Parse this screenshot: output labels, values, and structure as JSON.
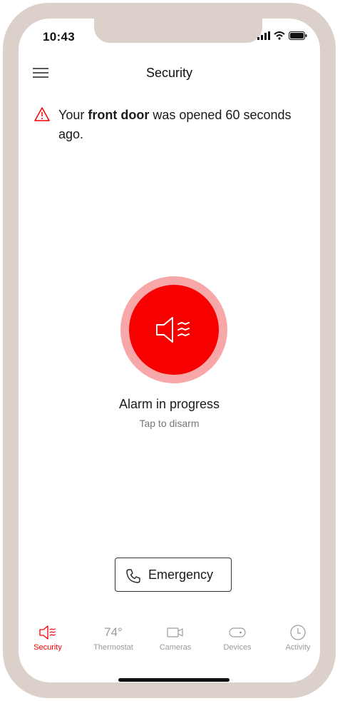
{
  "status_bar": {
    "time": "10:43"
  },
  "header": {
    "title": "Security"
  },
  "alert": {
    "prefix": "Your ",
    "bold": "front door",
    "suffix": " was opened 60 seconds ago."
  },
  "alarm": {
    "title": "Alarm in progress",
    "subtitle": "Tap to disarm"
  },
  "emergency": {
    "label": "Emergency"
  },
  "tabs": [
    {
      "label": "Security",
      "icon": "speaker-icon"
    },
    {
      "label": "Thermostat",
      "value": "74°"
    },
    {
      "label": "Cameras",
      "icon": "camera-icon"
    },
    {
      "label": "Devices",
      "icon": "device-icon"
    },
    {
      "label": "Activity",
      "icon": "clock-icon"
    }
  ],
  "colors": {
    "accent": "#f70000",
    "ring": "#f7a7a7",
    "frame": "#dcd1ca"
  }
}
